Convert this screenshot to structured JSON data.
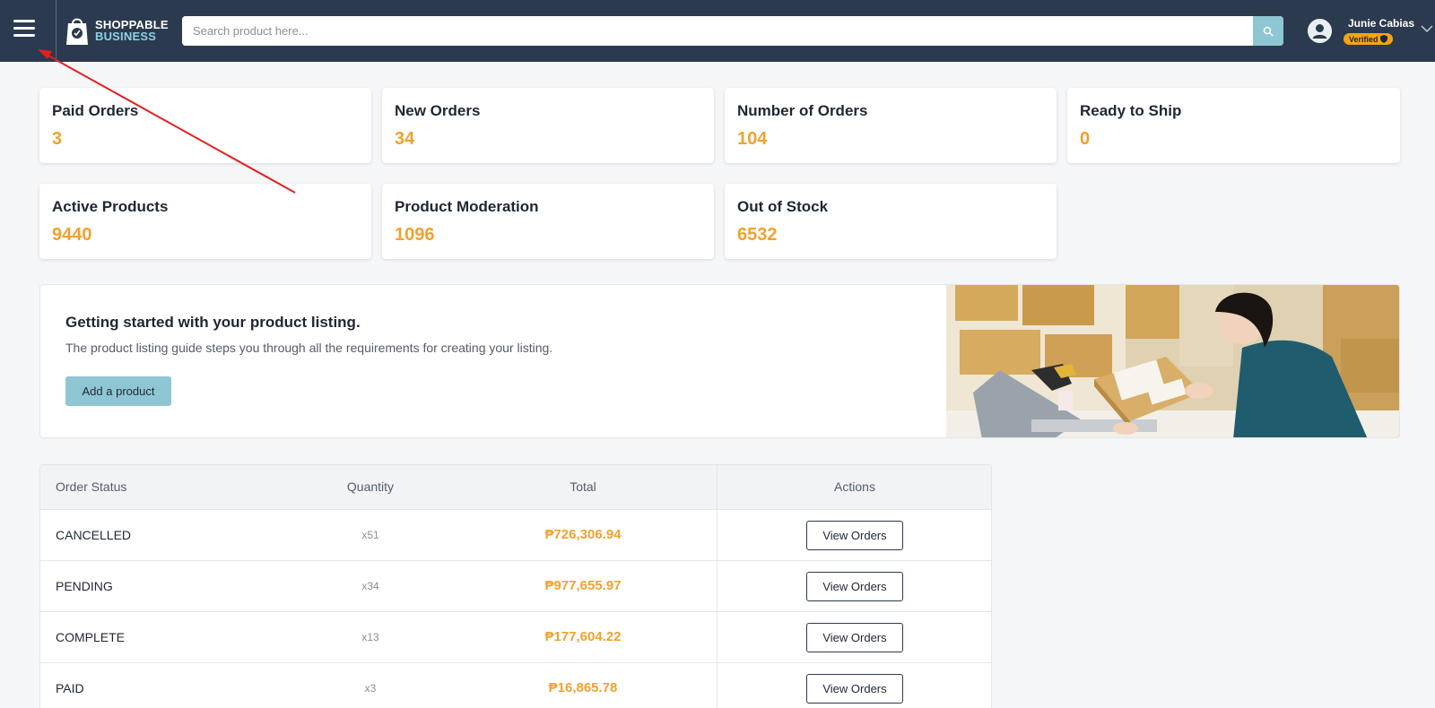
{
  "header": {
    "logo_line1": "SHOPPABLE",
    "logo_line2": "BUSINESS",
    "search_placeholder": "Search product here...",
    "user_name": "Junie Cabias",
    "verified_label": "Verified"
  },
  "stats": {
    "paid_orders": {
      "label": "Paid Orders",
      "value": "3"
    },
    "new_orders": {
      "label": "New Orders",
      "value": "34"
    },
    "number_of_orders": {
      "label": "Number of Orders",
      "value": "104"
    },
    "ready_to_ship": {
      "label": "Ready to Ship",
      "value": "0"
    },
    "active_products": {
      "label": "Active Products",
      "value": "9440"
    },
    "product_moderation": {
      "label": "Product Moderation",
      "value": "1096"
    },
    "out_of_stock": {
      "label": "Out of Stock",
      "value": "6532"
    }
  },
  "banner": {
    "title": "Getting started with your product listing.",
    "description": "The product listing guide steps you through all the requirements for creating your listing.",
    "button_label": "Add a product"
  },
  "orders_table": {
    "headers": {
      "status": "Order Status",
      "quantity": "Quantity",
      "total": "Total",
      "actions": "Actions"
    },
    "rows": [
      {
        "status": "CANCELLED",
        "quantity": "x51",
        "total": "₱726,306.94",
        "action": "View Orders"
      },
      {
        "status": "PENDING",
        "quantity": "x34",
        "total": "₱977,655.97",
        "action": "View Orders"
      },
      {
        "status": "COMPLETE",
        "quantity": "x13",
        "total": "₱177,604.22",
        "action": "View Orders"
      },
      {
        "status": "PAID",
        "quantity": "x3",
        "total": "₱16,865.78",
        "action": "View Orders"
      }
    ]
  },
  "colors": {
    "header_bg": "#2b3a4e",
    "accent_orange": "#f0a22e",
    "accent_blue": "#8fc6d4",
    "annotation_red": "#e02020"
  }
}
